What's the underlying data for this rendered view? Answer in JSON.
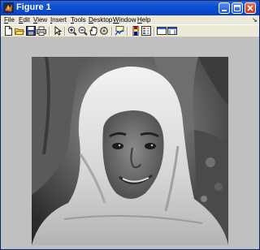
{
  "window": {
    "title": "Figure 1"
  },
  "menu": [
    {
      "label": "File",
      "accel": "F",
      "rest": "ile"
    },
    {
      "label": "Edit",
      "accel": "E",
      "rest": "dit"
    },
    {
      "label": "View",
      "accel": "V",
      "rest": "iew"
    },
    {
      "label": "Insert",
      "accel": "I",
      "rest": "nsert"
    },
    {
      "label": "Tools",
      "accel": "T",
      "rest": "ools"
    },
    {
      "label": "Desktop",
      "accel": "D",
      "rest": "esktop"
    },
    {
      "label": "Window",
      "accel": "W",
      "rest": "indow"
    },
    {
      "label": "Help",
      "accel": "H",
      "rest": "elp"
    }
  ],
  "toolbar": [
    "new-figure-icon",
    "open-file-icon",
    "save-icon",
    "print-icon",
    "edit-plot-arrow-icon",
    "zoom-in-icon",
    "zoom-out-icon",
    "pan-hand-icon",
    "rotate-3d-icon",
    "data-cursor-icon",
    "insert-colorbar-icon",
    "insert-legend-icon",
    "hide-plot-tools-icon",
    "show-plot-tools-icon"
  ],
  "figure": {
    "content": "grayscale-photo",
    "background": "#c0c0c0"
  },
  "colors": {
    "titlebar": "#0a4fd4",
    "chrome": "#ece9d8",
    "figure_bg": "#c0c0c0"
  }
}
